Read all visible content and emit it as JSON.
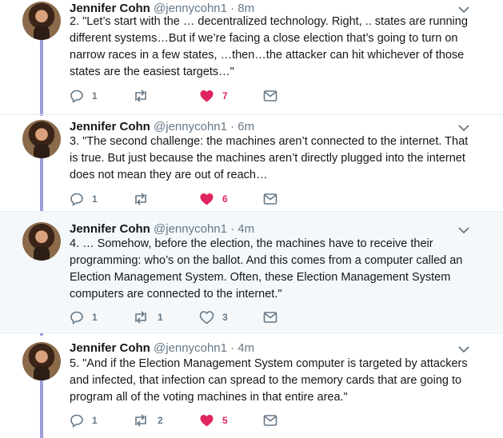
{
  "tweets": [
    {
      "name": "Jennifer Cohn",
      "handle": "@jennycohn1 · 8m",
      "text": "2. \"Let’s start with the … decentralized technology. Right, .. states are running different systems…But if we’re facing a close election that’s going to turn on narrow races in a few states, …then…the attacker can hit whichever of those states are the easiest targets…\"",
      "replies": "1",
      "retweets": "",
      "likes": "7",
      "liked": true
    },
    {
      "name": "Jennifer Cohn",
      "handle": "@jennycohn1 · 6m",
      "text": "3. \"The second challenge: the machines aren’t connected to the internet. That is true. But just because the machines aren’t directly plugged into the internet does not mean they are out of reach…",
      "replies": "1",
      "retweets": "",
      "likes": "6",
      "liked": true
    },
    {
      "name": "Jennifer Cohn",
      "handle": "@jennycohn1 · 4m",
      "text": "4. … Somehow, before the election, the machines have to receive their programming: who’s  on the ballot. And this comes from a computer called an Election  Management System. Often, these Election Management System computers are  connected to the internet.\"",
      "replies": "1",
      "retweets": "1",
      "likes": "3",
      "liked": false
    },
    {
      "name": "Jennifer Cohn",
      "handle": "@jennycohn1 · 4m",
      "text": "5. \"And if the Election Management System computer is targeted by  attackers and infected, that infection can  spread to the memory cards  that are going to program all of the voting  machines in that entire area.\"",
      "replies": "1",
      "retweets": "2",
      "likes": "5",
      "liked": true
    }
  ],
  "colors": {
    "like_active": "#e0245e",
    "icon_gray": "#657786",
    "thread_line": "#9b9ed9",
    "highlight_bg": "#f5f8fa"
  },
  "icons": [
    "reply-icon",
    "retweet-icon",
    "heart-icon",
    "dm-icon",
    "chevron-down-icon"
  ]
}
